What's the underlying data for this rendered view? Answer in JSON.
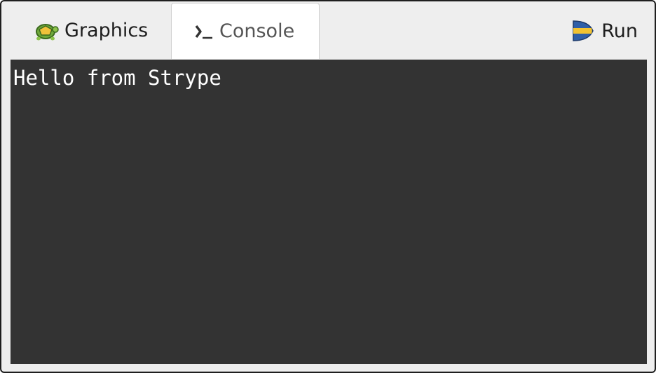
{
  "tabs": {
    "graphics": {
      "label": "Graphics",
      "icon": "turtle-icon"
    },
    "console": {
      "label": "Console",
      "icon": "terminal-prompt-icon",
      "active": true
    }
  },
  "run": {
    "label": "Run",
    "icon": "run-arrow-icon"
  },
  "console": {
    "lines": [
      "Hello from Strype"
    ]
  },
  "colors": {
    "console_bg": "#333333",
    "console_text": "#ffffff",
    "run_icon_blue": "#2f5fa8",
    "run_icon_yellow": "#f2c230"
  }
}
